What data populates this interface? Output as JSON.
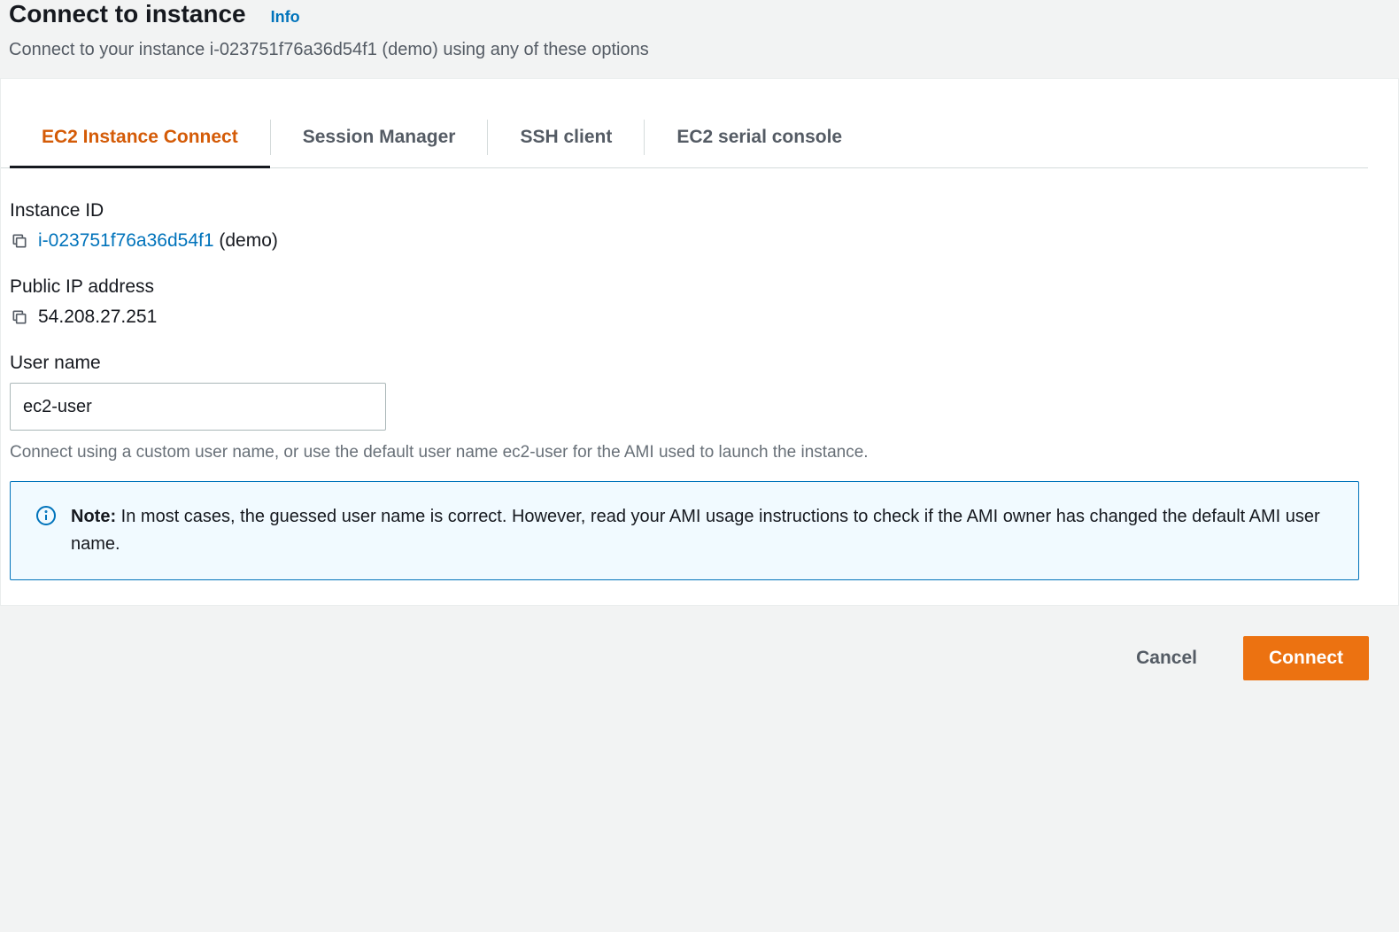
{
  "header": {
    "title": "Connect to instance",
    "info_link": "Info",
    "subtitle": "Connect to your instance i-023751f76a36d54f1 (demo) using any of these options"
  },
  "tabs": {
    "items": [
      {
        "label": "EC2 Instance Connect",
        "active": true
      },
      {
        "label": "Session Manager",
        "active": false
      },
      {
        "label": "SSH client",
        "active": false
      },
      {
        "label": "EC2 serial console",
        "active": false
      }
    ]
  },
  "fields": {
    "instance_id": {
      "label": "Instance ID",
      "value_link": "i-023751f76a36d54f1",
      "value_suffix": " (demo)"
    },
    "public_ip": {
      "label": "Public IP address",
      "value": "54.208.27.251"
    },
    "user_name": {
      "label": "User name",
      "value": "ec2-user",
      "help": "Connect using a custom user name, or use the default user name ec2-user for the AMI used to launch the instance."
    }
  },
  "notice": {
    "label": "Note: ",
    "text": "In most cases, the guessed user name is correct. However, read your AMI usage instructions to check if the AMI owner has changed the default AMI user name."
  },
  "footer": {
    "cancel": "Cancel",
    "connect": "Connect"
  }
}
